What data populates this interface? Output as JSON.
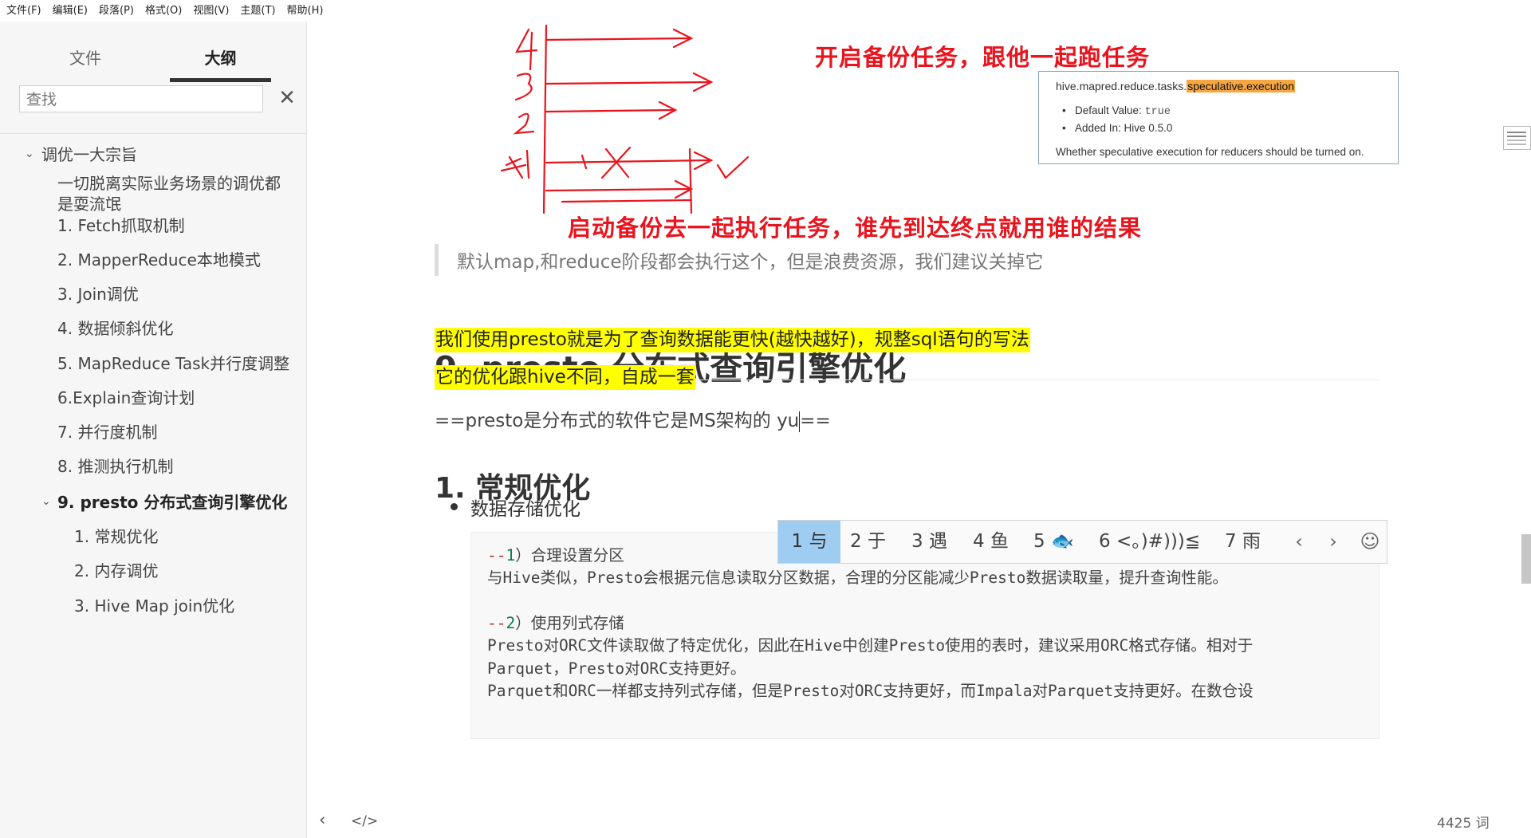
{
  "menu": [
    "文件(F)",
    "编辑(E)",
    "段落(P)",
    "格式(O)",
    "视图(V)",
    "主题(T)",
    "帮助(H)"
  ],
  "sidebar": {
    "tabs": {
      "files": "文件",
      "outline": "大纲"
    },
    "search_placeholder": "查找",
    "close_glyph": "✕",
    "outline": [
      {
        "label": "调优一大宗旨",
        "expanded": true
      },
      {
        "label": "一切脱离实际业务场景的调优都是耍流氓"
      },
      {
        "label": "1. Fetch抓取机制"
      },
      {
        "label": "2. MapperReduce本地模式"
      },
      {
        "label": "3. Join调优"
      },
      {
        "label": "4. 数据倾斜优化"
      },
      {
        "label": "5. MapReduce Task并行度调整"
      },
      {
        "label": "6.Explain查询计划"
      },
      {
        "label": "7. 并行度机制"
      },
      {
        "label": "8. 推测执行机制"
      },
      {
        "label": "9. presto 分布式查询引擎优化",
        "active": true,
        "expanded": true
      },
      {
        "label": "1. 常规优化"
      },
      {
        "label": "2. 内存调优"
      },
      {
        "label": "3. Hive Map join优化"
      }
    ]
  },
  "figure": {
    "annotation_top": "开启备份任务，跟他一起跑任务",
    "annotation_bottom": "启动备份去一起执行任务，谁先到达终点就用谁的结果",
    "hive_card": {
      "prop_prefix": "hive.mapred.reduce.tasks.",
      "prop_highlight": "speculative.execution",
      "default_label": "Default Value: ",
      "default_value": "true",
      "added_in": "Added In: Hive 0.5.0",
      "description": "Whether speculative execution for reducers should be turned on."
    }
  },
  "content": {
    "quote": "默认map,和reduce阶段都会执行这个，但是浪费资源，我们建议关掉它",
    "h2": "9. presto 分布式查询引擎优化",
    "highlight1": "我们使用presto就是为了查询数据能更快(越快越好)，规整sql语句的写法",
    "highlight2": "它的优化跟hive不同，自成一套",
    "typing_line_before": "==presto是分布式的软件它是MS架构的 yu",
    "typing_line_after": "==",
    "h3": "1. 常规优化",
    "bullet": "数据存储优化",
    "code": {
      "l1_comment": "--",
      "l1_num": "1",
      "l1_rest": "）合理设置分区",
      "l2": "    与Hive类似，Presto会根据元信息读取分区数据，合理的分区能减少Presto数据读取量，提升查询性能。",
      "l3_comment": "--",
      "l3_num": "2",
      "l3_rest": "）使用列式存储",
      "l4": "    Presto对ORC文件读取做了特定优化，因此在Hive中创建Presto使用的表时，建议采用ORC格式存储。相对于",
      "l5": "Parquet，Presto对ORC支持更好。",
      "l6": "    Parquet和ORC一样都支持列式存储，但是Presto对ORC支持更好，而Impala对Parquet支持更好。在数仓设"
    }
  },
  "ime": {
    "candidates": [
      "1 与",
      "2 于",
      "3 遇",
      "4 鱼",
      "5 🐟",
      "6 <。)#)))≦",
      "7 雨"
    ],
    "prev": "‹",
    "next": "›",
    "emoji": "☺"
  },
  "footer": {
    "back": "‹",
    "source_toggle": "</>",
    "word_count": "4425 词"
  }
}
